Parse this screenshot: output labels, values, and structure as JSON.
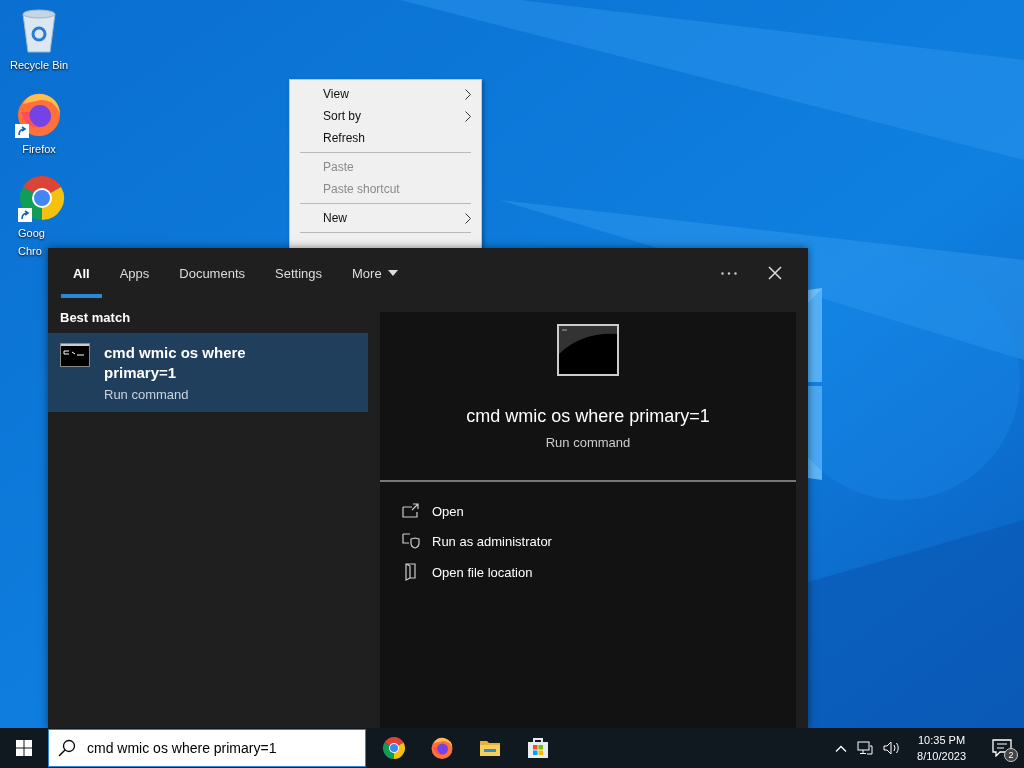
{
  "desktop_icons": [
    {
      "kind": "recycle-bin",
      "lines": [
        "Recycle Bin"
      ],
      "shortcut": false
    },
    {
      "kind": "firefox",
      "lines": [
        "Firefox"
      ],
      "shortcut": true
    },
    {
      "kind": "chrome",
      "lines": [
        "Goog",
        "Chro"
      ],
      "shortcut": true
    }
  ],
  "context_menu": {
    "items": [
      {
        "kind": "item",
        "label": "View",
        "submenu": true,
        "disabled": false
      },
      {
        "kind": "item",
        "label": "Sort by",
        "submenu": true,
        "disabled": false
      },
      {
        "kind": "item",
        "label": "Refresh",
        "submenu": false,
        "disabled": false
      },
      {
        "kind": "separator"
      },
      {
        "kind": "item",
        "label": "Paste",
        "submenu": false,
        "disabled": true
      },
      {
        "kind": "item",
        "label": "Paste shortcut",
        "submenu": false,
        "disabled": true
      },
      {
        "kind": "separator"
      },
      {
        "kind": "item",
        "label": "New",
        "submenu": true,
        "disabled": false
      },
      {
        "kind": "separator"
      }
    ]
  },
  "search_panel": {
    "tabs": [
      {
        "label": "All",
        "selected": true,
        "dropdown": false
      },
      {
        "label": "Apps",
        "selected": false,
        "dropdown": false
      },
      {
        "label": "Documents",
        "selected": false,
        "dropdown": false
      },
      {
        "label": "Settings",
        "selected": false,
        "dropdown": false
      },
      {
        "label": "More",
        "selected": false,
        "dropdown": true
      }
    ],
    "best_match_heading": "Best match",
    "result": {
      "title": "cmd wmic os where primary=1",
      "subtitle": "Run command",
      "selected": true
    },
    "preview": {
      "title": "cmd wmic os where primary=1",
      "subtitle": "Run command"
    },
    "actions": [
      {
        "kind": "open",
        "label": "Open"
      },
      {
        "kind": "admin",
        "label": "Run as administrator"
      },
      {
        "kind": "folder",
        "label": "Open file location"
      }
    ]
  },
  "taskbar": {
    "search_value": "cmd wmic os where primary=1",
    "pinned": [
      {
        "kind": "chrome"
      },
      {
        "kind": "firefox"
      },
      {
        "kind": "folder"
      },
      {
        "kind": "store"
      }
    ],
    "time": "10:35 PM",
    "date": "8/10/2023",
    "notification_count": "2"
  }
}
